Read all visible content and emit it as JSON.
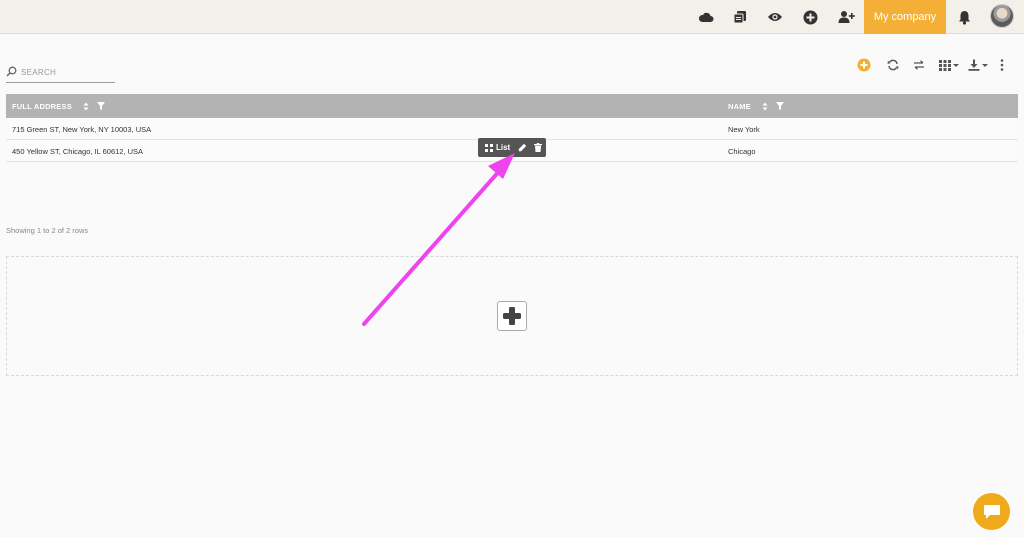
{
  "nav": {
    "icons": [
      "cloud-icon",
      "documents-icon",
      "eye-icon",
      "plus-circle-icon",
      "add-user-icon",
      "bell-icon"
    ],
    "company_label": "My company",
    "accent": "#f4b036"
  },
  "search": {
    "placeholder": "SEARCH",
    "value": ""
  },
  "toolbar": {
    "icons": [
      "add-circle-icon",
      "refresh-icon",
      "transfer-icon",
      "grid-columns-icon",
      "download-icon",
      "more-vertical-icon"
    ]
  },
  "table": {
    "columns": [
      {
        "label": "FULL ADDRESS"
      },
      {
        "label": "NAME"
      }
    ],
    "rows": [
      {
        "full_address": "715 Green ST, New York, NY 10003, USA",
        "name": "New York"
      },
      {
        "full_address": "450 Yellow ST, Chicago, IL 60612, USA",
        "name": "Chicago"
      }
    ]
  },
  "widget": {
    "label": "List"
  },
  "pager": {
    "text": "Showing 1 to 2 of 2 rows"
  },
  "chat": {
    "color": "#f1a91c"
  },
  "arrow": {
    "color": "#ee44ee"
  }
}
